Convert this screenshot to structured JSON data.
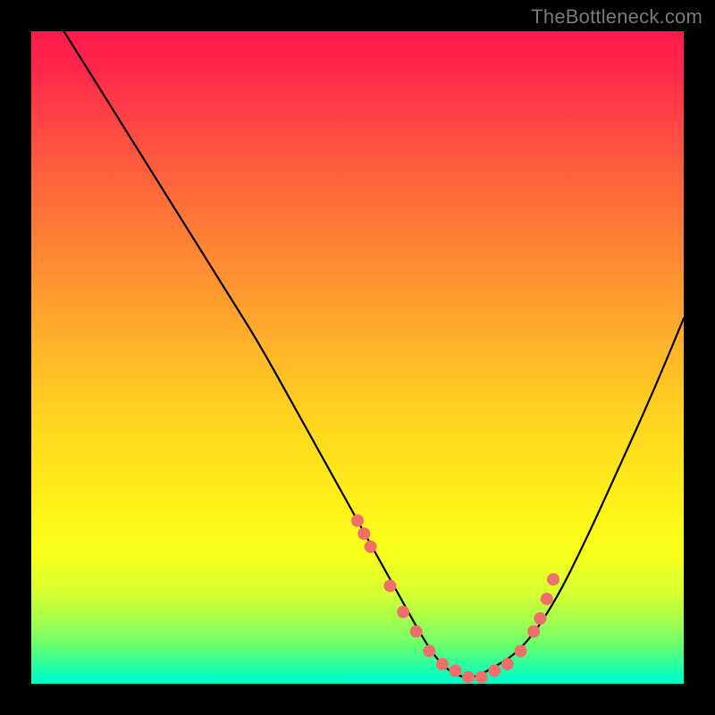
{
  "watermark": "TheBottleneck.com",
  "chart_data": {
    "type": "line",
    "title": "",
    "xlabel": "",
    "ylabel": "",
    "xlim": [
      0,
      100
    ],
    "ylim": [
      0,
      100
    ],
    "curve": {
      "name": "bottleneck-curve",
      "x": [
        5,
        10,
        15,
        20,
        25,
        30,
        35,
        40,
        45,
        50,
        55,
        60,
        62,
        64,
        66,
        68,
        70,
        75,
        80,
        85,
        90,
        95,
        100
      ],
      "y": [
        100,
        92,
        84,
        76,
        68,
        60,
        52,
        43,
        34,
        25,
        16,
        7,
        4,
        2,
        1,
        1,
        2,
        5,
        12,
        22,
        33,
        44,
        56
      ]
    },
    "markers": {
      "name": "highlight-points",
      "x": [
        50,
        51,
        52,
        55,
        57,
        59,
        61,
        63,
        65,
        67,
        69,
        71,
        73,
        75,
        77,
        78,
        79,
        80
      ],
      "y": [
        25,
        23,
        21,
        15,
        11,
        8,
        5,
        3,
        2,
        1,
        1,
        2,
        3,
        5,
        8,
        10,
        13,
        16
      ]
    },
    "background_gradient": {
      "top": "#ff1a4d",
      "mid": "#fff019",
      "bottom": "#00ffc0"
    }
  }
}
